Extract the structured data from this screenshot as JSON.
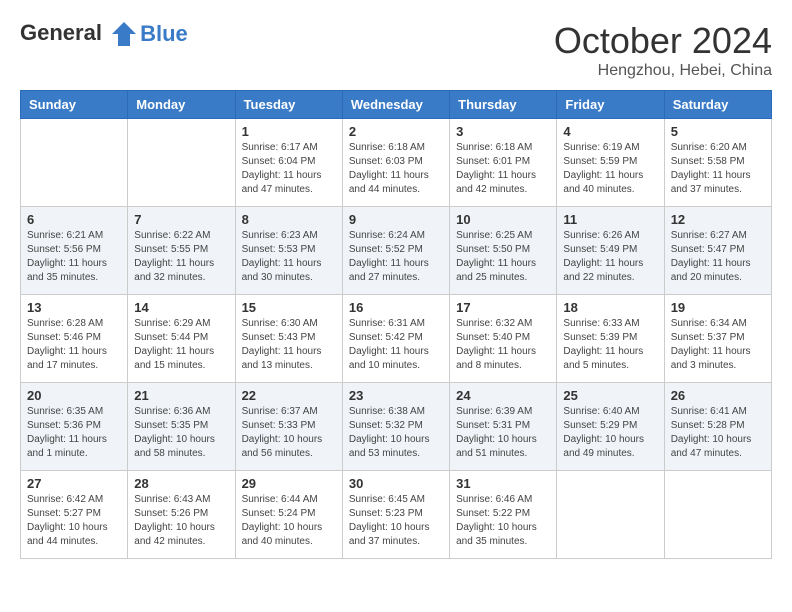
{
  "header": {
    "logo_line1": "General",
    "logo_line2": "Blue",
    "month": "October 2024",
    "location": "Hengzhou, Hebei, China"
  },
  "weekdays": [
    "Sunday",
    "Monday",
    "Tuesday",
    "Wednesday",
    "Thursday",
    "Friday",
    "Saturday"
  ],
  "weeks": [
    [
      {
        "day": "",
        "info": ""
      },
      {
        "day": "",
        "info": ""
      },
      {
        "day": "1",
        "info": "Sunrise: 6:17 AM\nSunset: 6:04 PM\nDaylight: 11 hours and 47 minutes."
      },
      {
        "day": "2",
        "info": "Sunrise: 6:18 AM\nSunset: 6:03 PM\nDaylight: 11 hours and 44 minutes."
      },
      {
        "day": "3",
        "info": "Sunrise: 6:18 AM\nSunset: 6:01 PM\nDaylight: 11 hours and 42 minutes."
      },
      {
        "day": "4",
        "info": "Sunrise: 6:19 AM\nSunset: 5:59 PM\nDaylight: 11 hours and 40 minutes."
      },
      {
        "day": "5",
        "info": "Sunrise: 6:20 AM\nSunset: 5:58 PM\nDaylight: 11 hours and 37 minutes."
      }
    ],
    [
      {
        "day": "6",
        "info": "Sunrise: 6:21 AM\nSunset: 5:56 PM\nDaylight: 11 hours and 35 minutes."
      },
      {
        "day": "7",
        "info": "Sunrise: 6:22 AM\nSunset: 5:55 PM\nDaylight: 11 hours and 32 minutes."
      },
      {
        "day": "8",
        "info": "Sunrise: 6:23 AM\nSunset: 5:53 PM\nDaylight: 11 hours and 30 minutes."
      },
      {
        "day": "9",
        "info": "Sunrise: 6:24 AM\nSunset: 5:52 PM\nDaylight: 11 hours and 27 minutes."
      },
      {
        "day": "10",
        "info": "Sunrise: 6:25 AM\nSunset: 5:50 PM\nDaylight: 11 hours and 25 minutes."
      },
      {
        "day": "11",
        "info": "Sunrise: 6:26 AM\nSunset: 5:49 PM\nDaylight: 11 hours and 22 minutes."
      },
      {
        "day": "12",
        "info": "Sunrise: 6:27 AM\nSunset: 5:47 PM\nDaylight: 11 hours and 20 minutes."
      }
    ],
    [
      {
        "day": "13",
        "info": "Sunrise: 6:28 AM\nSunset: 5:46 PM\nDaylight: 11 hours and 17 minutes."
      },
      {
        "day": "14",
        "info": "Sunrise: 6:29 AM\nSunset: 5:44 PM\nDaylight: 11 hours and 15 minutes."
      },
      {
        "day": "15",
        "info": "Sunrise: 6:30 AM\nSunset: 5:43 PM\nDaylight: 11 hours and 13 minutes."
      },
      {
        "day": "16",
        "info": "Sunrise: 6:31 AM\nSunset: 5:42 PM\nDaylight: 11 hours and 10 minutes."
      },
      {
        "day": "17",
        "info": "Sunrise: 6:32 AM\nSunset: 5:40 PM\nDaylight: 11 hours and 8 minutes."
      },
      {
        "day": "18",
        "info": "Sunrise: 6:33 AM\nSunset: 5:39 PM\nDaylight: 11 hours and 5 minutes."
      },
      {
        "day": "19",
        "info": "Sunrise: 6:34 AM\nSunset: 5:37 PM\nDaylight: 11 hours and 3 minutes."
      }
    ],
    [
      {
        "day": "20",
        "info": "Sunrise: 6:35 AM\nSunset: 5:36 PM\nDaylight: 11 hours and 1 minute."
      },
      {
        "day": "21",
        "info": "Sunrise: 6:36 AM\nSunset: 5:35 PM\nDaylight: 10 hours and 58 minutes."
      },
      {
        "day": "22",
        "info": "Sunrise: 6:37 AM\nSunset: 5:33 PM\nDaylight: 10 hours and 56 minutes."
      },
      {
        "day": "23",
        "info": "Sunrise: 6:38 AM\nSunset: 5:32 PM\nDaylight: 10 hours and 53 minutes."
      },
      {
        "day": "24",
        "info": "Sunrise: 6:39 AM\nSunset: 5:31 PM\nDaylight: 10 hours and 51 minutes."
      },
      {
        "day": "25",
        "info": "Sunrise: 6:40 AM\nSunset: 5:29 PM\nDaylight: 10 hours and 49 minutes."
      },
      {
        "day": "26",
        "info": "Sunrise: 6:41 AM\nSunset: 5:28 PM\nDaylight: 10 hours and 47 minutes."
      }
    ],
    [
      {
        "day": "27",
        "info": "Sunrise: 6:42 AM\nSunset: 5:27 PM\nDaylight: 10 hours and 44 minutes."
      },
      {
        "day": "28",
        "info": "Sunrise: 6:43 AM\nSunset: 5:26 PM\nDaylight: 10 hours and 42 minutes."
      },
      {
        "day": "29",
        "info": "Sunrise: 6:44 AM\nSunset: 5:24 PM\nDaylight: 10 hours and 40 minutes."
      },
      {
        "day": "30",
        "info": "Sunrise: 6:45 AM\nSunset: 5:23 PM\nDaylight: 10 hours and 37 minutes."
      },
      {
        "day": "31",
        "info": "Sunrise: 6:46 AM\nSunset: 5:22 PM\nDaylight: 10 hours and 35 minutes."
      },
      {
        "day": "",
        "info": ""
      },
      {
        "day": "",
        "info": ""
      }
    ]
  ]
}
